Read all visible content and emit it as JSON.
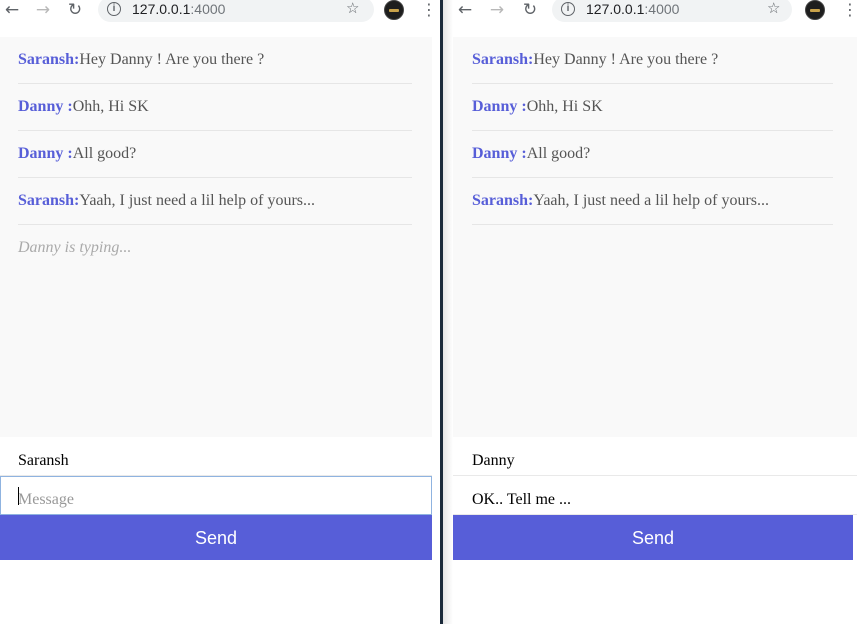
{
  "colors": {
    "accent": "#575ed8",
    "chat_background": "#f9f9f9",
    "divider": "#1b2a3a"
  },
  "browser": {
    "url_host": "127.0.0.1",
    "url_port": ":4000",
    "icons": {
      "back": "back-arrow-icon",
      "forward": "forward-arrow-icon",
      "reload": "reload-icon",
      "info": "info-icon",
      "bookmark": "star-icon",
      "menu": "kebab-menu-icon"
    }
  },
  "left_window": {
    "messages": [
      {
        "author": "Saransh:",
        "text": "Hey Danny ! Are you there ?"
      },
      {
        "author": "Danny :",
        "text": "Ohh, Hi SK"
      },
      {
        "author": "Danny :",
        "text": "All good?"
      },
      {
        "author": "Saransh:",
        "text": "Yaah, I just need a lil help of yours..."
      }
    ],
    "feedback": "Danny is typing...",
    "handle_value": "Saransh",
    "message_placeholder": "Message",
    "message_value": "",
    "send_label": "Send"
  },
  "right_window": {
    "messages": [
      {
        "author": "Saransh:",
        "text": "Hey Danny ! Are you there ?"
      },
      {
        "author": "Danny :",
        "text": "Ohh, Hi SK"
      },
      {
        "author": "Danny :",
        "text": "All good?"
      },
      {
        "author": "Saransh:",
        "text": "Yaah, I just need a lil help of yours..."
      }
    ],
    "handle_value": "Danny",
    "message_value": "OK.. Tell me ...",
    "send_label": "Send"
  }
}
